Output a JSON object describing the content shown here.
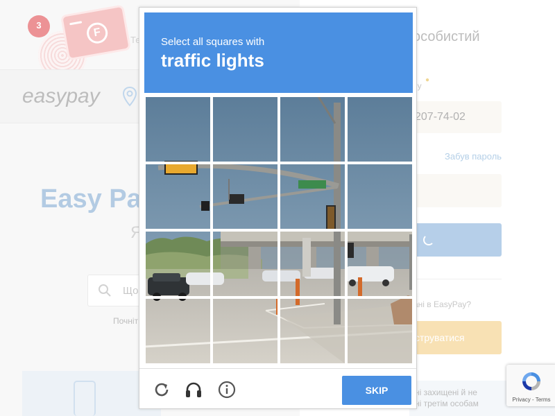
{
  "captcha": {
    "instruction": "Select all squares with",
    "target": "traffic lights",
    "skip_label": "SKIP",
    "colors": {
      "header": "#4a90e2",
      "button": "#4a90e2"
    }
  },
  "background_page": {
    "promo_badge": "3",
    "card_letter": "F",
    "logo_text": "easypay",
    "hero_title": "Easy Pay",
    "hero_subtitle_fragment": "Я",
    "search_placeholder_fragment": "Що",
    "search_hint_fragment": "Почніт",
    "phone_label_fragment": "Телефон",
    "login_title_fragment": "особистий",
    "phone_field_label_fragment": "ну",
    "phone_value_fragment": "207-74-02",
    "forgot_password": "Забув пароль",
    "no_account_question_fragment": "ані в EasyPay?",
    "register_fragment": "струватися",
    "protection_text_line1": "ні захищені й не",
    "protection_text_line2": "ні третім особам",
    "colors": {
      "brand_blue": "#8ab0d4",
      "register_yellow": "#f4d18d",
      "login_blue": "#8fb6de"
    }
  },
  "recaptcha_badge": {
    "text": "Privacy - Terms"
  }
}
